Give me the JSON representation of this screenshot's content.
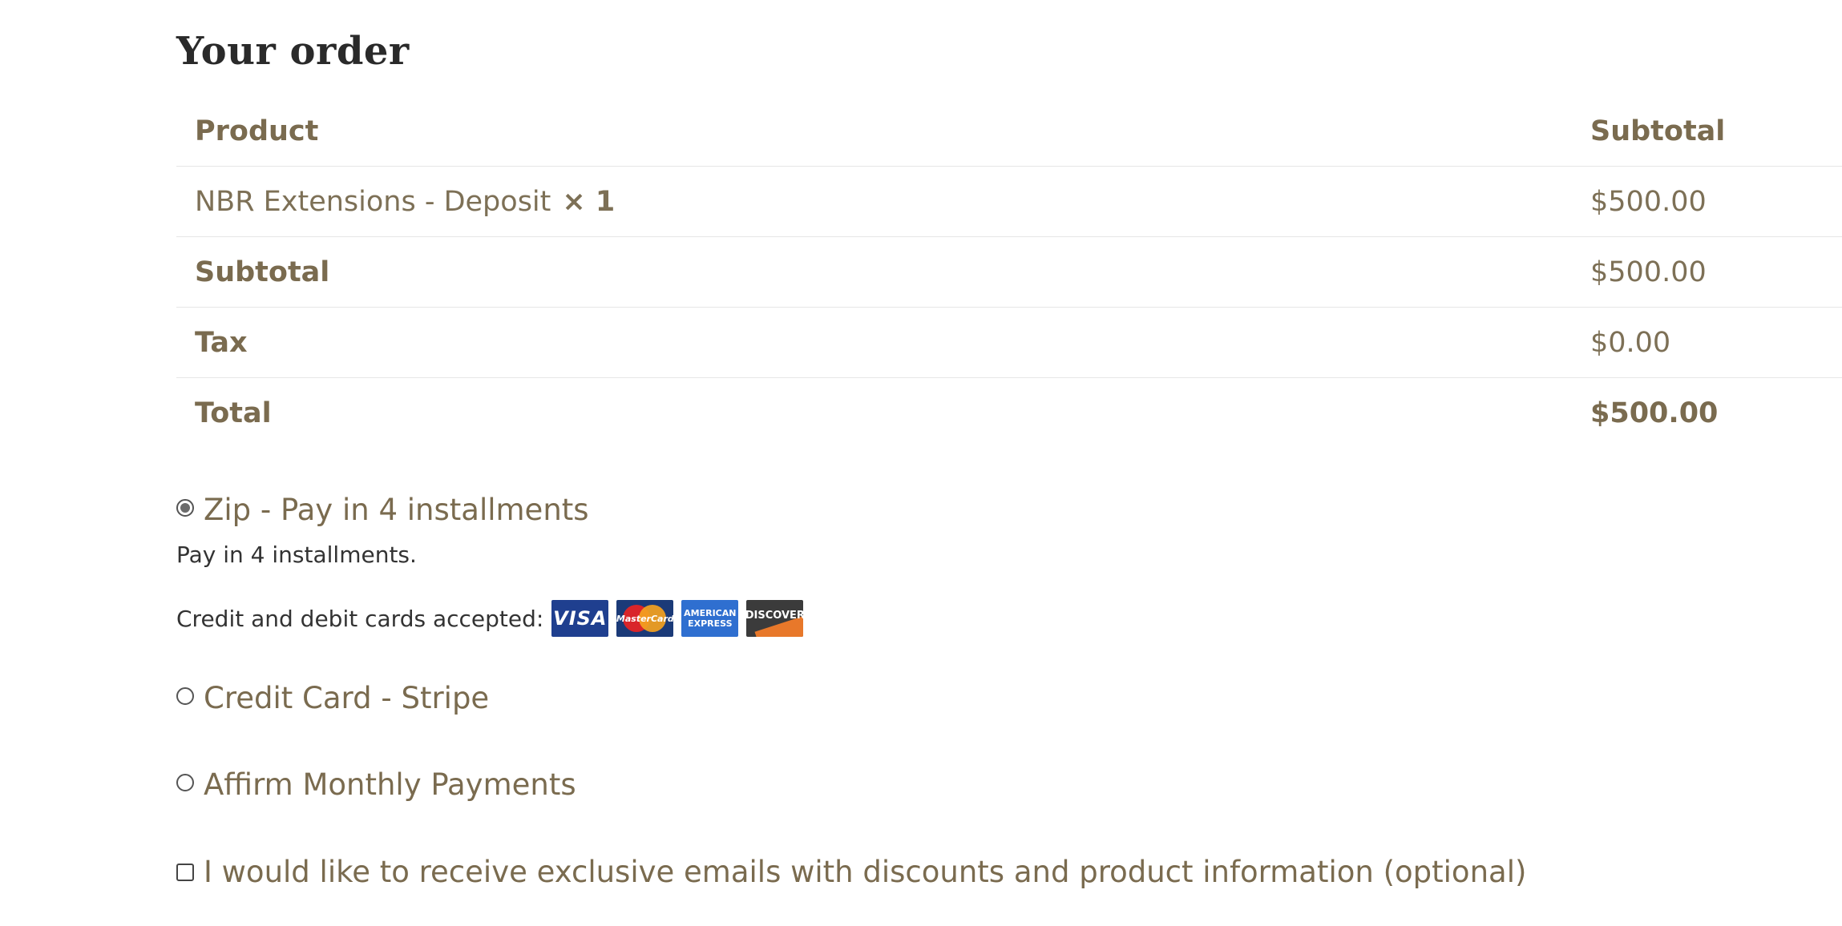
{
  "order": {
    "title": "Your order",
    "columns": {
      "product": "Product",
      "subtotal": "Subtotal"
    },
    "items": [
      {
        "name": "NBR Extensions - Deposit",
        "qty": "× 1",
        "price": "$500.00"
      }
    ],
    "subtotal": {
      "label": "Subtotal",
      "value": "$500.00"
    },
    "tax": {
      "label": "Tax",
      "value": "$0.00"
    },
    "total": {
      "label": "Total",
      "value": "$500.00"
    }
  },
  "payment": {
    "methods": [
      {
        "label": "Zip - Pay in 4 installments",
        "selected": true
      },
      {
        "label": "Credit Card - Stripe",
        "selected": false
      },
      {
        "label": "Affirm Monthly Payments",
        "selected": false
      }
    ],
    "zip_description": "Pay in 4 installments.",
    "cards_label": "Credit and debit cards accepted:",
    "cards": {
      "visa": "VISA",
      "mastercard": "MasterCard",
      "amex_line1": "AMERICAN",
      "amex_line2": "EXPRESS",
      "discover": "DISCOVER"
    }
  },
  "newsletter": {
    "label": "I would like to receive exclusive emails with discounts and product information (optional)",
    "checked": false
  },
  "colors": {
    "text_brand": "#7a6b4f",
    "heading": "#2a2a2a",
    "divider": "#e6e6e6"
  }
}
